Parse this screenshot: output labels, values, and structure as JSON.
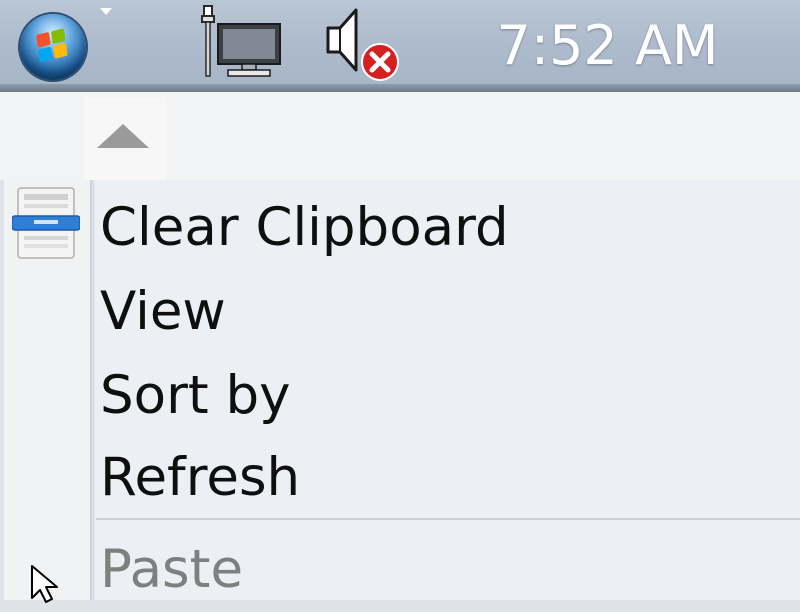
{
  "taskbar": {
    "start_button_icon": "windows-start-orb-icon",
    "overflow_icon": "chevron-down-icon",
    "network_icon": "network-computer-icon",
    "volume_icon": "volume-muted-error-icon",
    "clock": "7:52 AM"
  },
  "menu": {
    "scroll_up_icon": "scroll-up-arrow-icon",
    "items": [
      {
        "label": "Clear Clipboard",
        "icon": "clipboard-icon",
        "enabled": true
      },
      {
        "label": "View",
        "enabled": true
      },
      {
        "label": "Sort by",
        "enabled": true
      },
      {
        "label": "Refresh",
        "enabled": true
      },
      {
        "label": "Paste",
        "enabled": false
      }
    ]
  },
  "colors": {
    "taskbar": "#aebccd",
    "menu_background": "#eceff4",
    "text": "#0f0f0f",
    "disabled_text": "#7f7f7f",
    "mute_badge": "#d42020"
  }
}
